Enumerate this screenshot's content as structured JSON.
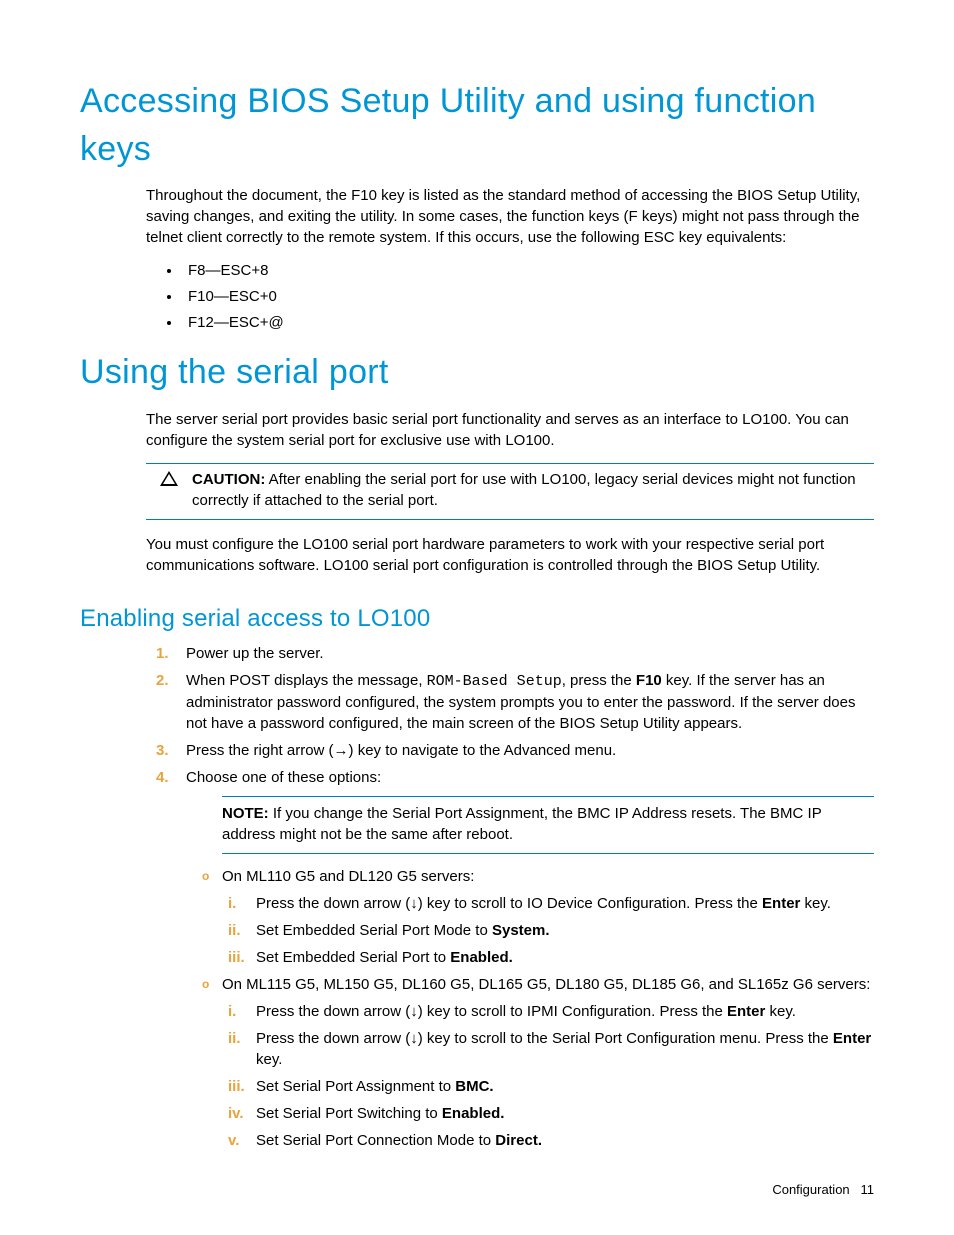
{
  "sec1": {
    "title": "Accessing BIOS Setup Utility and using function keys",
    "intro": "Throughout the document, the F10 key is listed as the standard method of accessing the BIOS Setup Utility, saving changes, and exiting the utility. In some cases, the function keys (F keys) might not pass through the telnet client correctly to the remote system. If this occurs, use the following ESC key equivalents:",
    "b1": "F8—ESC+8",
    "b2": "F10—ESC+0",
    "b3": "F12—ESC+@"
  },
  "sec2": {
    "title": "Using the serial port",
    "intro": "The server serial port provides basic serial port functionality and serves as an interface to LO100. You can configure the system serial port for exclusive use with LO100.",
    "caution_label": "CAUTION:",
    "caution_text": "  After enabling the serial port for use with LO100, legacy serial devices might not function correctly if attached to the serial port.",
    "after_caution": "You must configure the LO100 serial port hardware parameters to work with your respective serial port communications software. LO100 serial port configuration is controlled through the BIOS Setup Utility."
  },
  "sec3": {
    "title": "Enabling serial access to LO100",
    "s1": "Power up the server.",
    "s2a": "When POST displays the message, ",
    "s2b": "ROM-Based Setup",
    "s2c": ", press the ",
    "s2d": "F10",
    "s2e": " key. If the server has an administrator password configured, the system prompts you to enter the password. If the server does not have a password configured, the main screen of the BIOS Setup Utility appears.",
    "s3": "Press the right arrow (→) key to navigate to the Advanced menu.",
    "s4": "Choose one of these options:",
    "note_label": "NOTE:",
    "note_text": "  If you change the Serial Port Assignment, the BMC IP Address resets. The BMC IP address might not be the same after reboot.",
    "optA": "On ML110 G5 and DL120 G5 servers:",
    "a_i_a": "Press the down arrow (↓) key to scroll to IO Device Configuration. Press the ",
    "a_i_b": "Enter",
    "a_i_c": " key.",
    "a_ii_a": "Set Embedded Serial Port Mode to ",
    "a_ii_b": "System.",
    "a_iii_a": "Set Embedded Serial Port to ",
    "a_iii_b": "Enabled.",
    "optB": "On ML115 G5, ML150 G5, DL160 G5, DL165 G5, DL180 G5, DL185 G6, and SL165z G6 servers:",
    "b_i_a": "Press the down arrow (↓) key to scroll to IPMI Configuration. Press the ",
    "b_i_b": "Enter",
    "b_i_c": " key.",
    "b_ii_a": "Press the down arrow (↓) key to scroll to the Serial Port Configuration menu.  Press the ",
    "b_ii_b": "Enter",
    "b_ii_c": " key.",
    "b_iii_a": "Set Serial Port Assignment to ",
    "b_iii_b": "BMC.",
    "b_iv_a": "Set Serial Port Switching to ",
    "b_iv_b": "Enabled.",
    "b_v_a": "Set Serial Port Connection Mode to ",
    "b_v_b": "Direct."
  },
  "footer": {
    "label": "Configuration",
    "page": "11"
  }
}
